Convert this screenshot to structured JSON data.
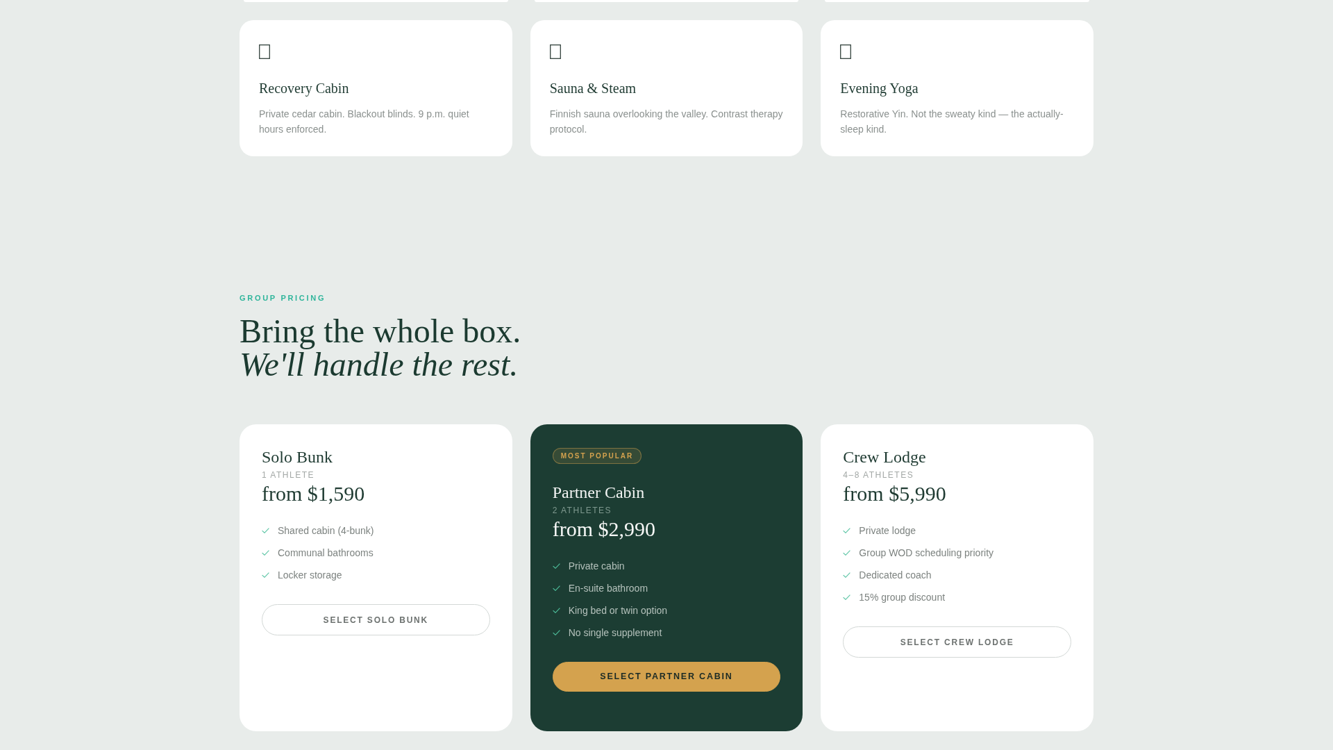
{
  "features": [
    {
      "title": "Recovery Cabin",
      "description": "Private cedar cabin. Blackout blinds. 9 p.m. quiet hours enforced."
    },
    {
      "title": "Sauna & Steam",
      "description": "Finnish sauna overlooking the valley. Contrast therapy protocol."
    },
    {
      "title": "Evening Yoga",
      "description": "Restorative Yin. Not the sweaty kind — the actually-sleep kind."
    }
  ],
  "pricing": {
    "eyebrow": "GROUP PRICING",
    "heading": "Bring the whole box. *We'll handle the rest.*",
    "plans": [
      {
        "name": "Solo Bunk",
        "capacity": "1 ATHLETE",
        "price": "from $1,590",
        "features": [
          "Shared cabin (4-bunk)",
          "Communal bathrooms",
          "Locker storage"
        ],
        "button": "SELECT SOLO BUNK",
        "featured": false
      },
      {
        "badge": "MOST POPULAR",
        "name": "Partner Cabin",
        "capacity": "2 ATHLETES",
        "price": "from $2,990",
        "features": [
          "Private cabin",
          "En-suite bathroom",
          "King bed or twin option",
          "No single supplement"
        ],
        "button": "SELECT PARTNER CABIN",
        "featured": true
      },
      {
        "name": "Crew Lodge",
        "capacity": "4–8 ATHLETES",
        "price": "from $5,990",
        "features": [
          "Private lodge",
          "Group WOD scheduling priority",
          "Dedicated coach",
          "15% group discount"
        ],
        "button": "SELECT CREW LODGE",
        "featured": false
      }
    ]
  }
}
